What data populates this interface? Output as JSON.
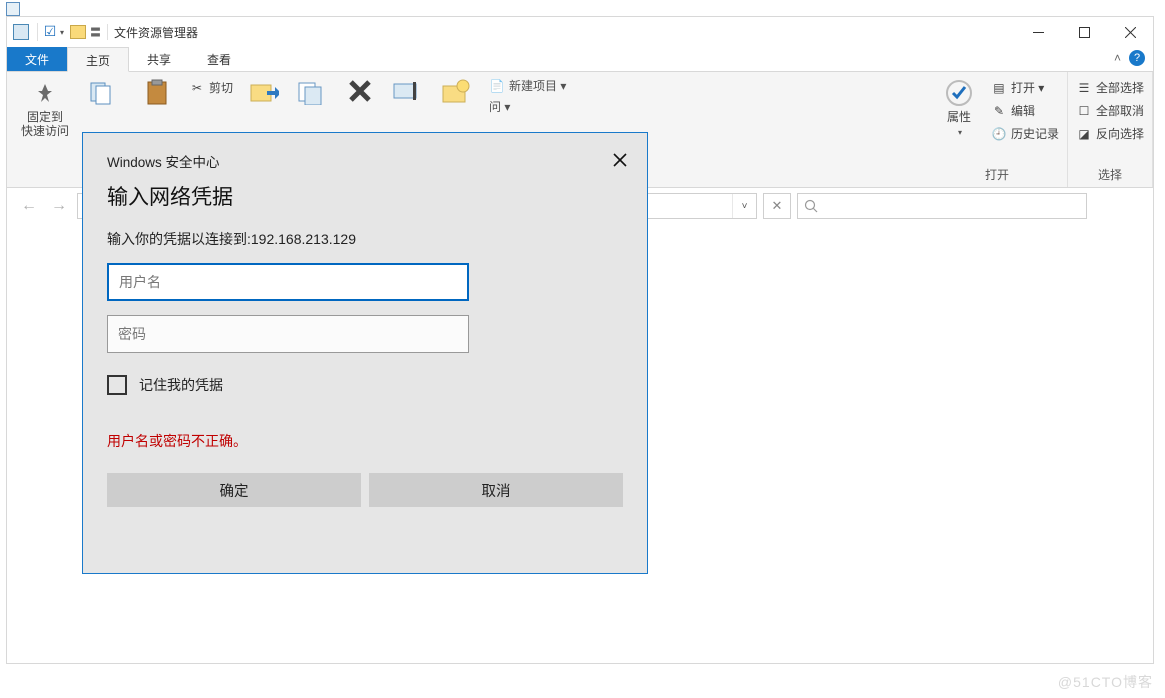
{
  "window": {
    "title": "文件资源管理器"
  },
  "tabs": {
    "file": "文件",
    "home": "主页",
    "share": "共享",
    "view": "查看"
  },
  "ribbon": {
    "pin": "固定到\n快速访问",
    "cut": "剪切",
    "access_suffix": "问 ▾",
    "new_item": "新建项目 ▾",
    "properties": "属性",
    "open_btn": "打开 ▾",
    "edit": "编辑",
    "history": "历史记录",
    "open_group": "打开",
    "select_all": "全部选择",
    "deselect_all": "全部取消",
    "invert": "反向选择",
    "select_group": "选择"
  },
  "dialog": {
    "title": "Windows 安全中心",
    "heading": "输入网络凭据",
    "subtext": "输入你的凭据以连接到:192.168.213.129",
    "user_ph": "用户名",
    "pass_ph": "密码",
    "remember": "记住我的凭据",
    "error": "用户名或密码不正确。",
    "ok": "确定",
    "cancel": "取消"
  },
  "watermark": "@51CTO博客"
}
